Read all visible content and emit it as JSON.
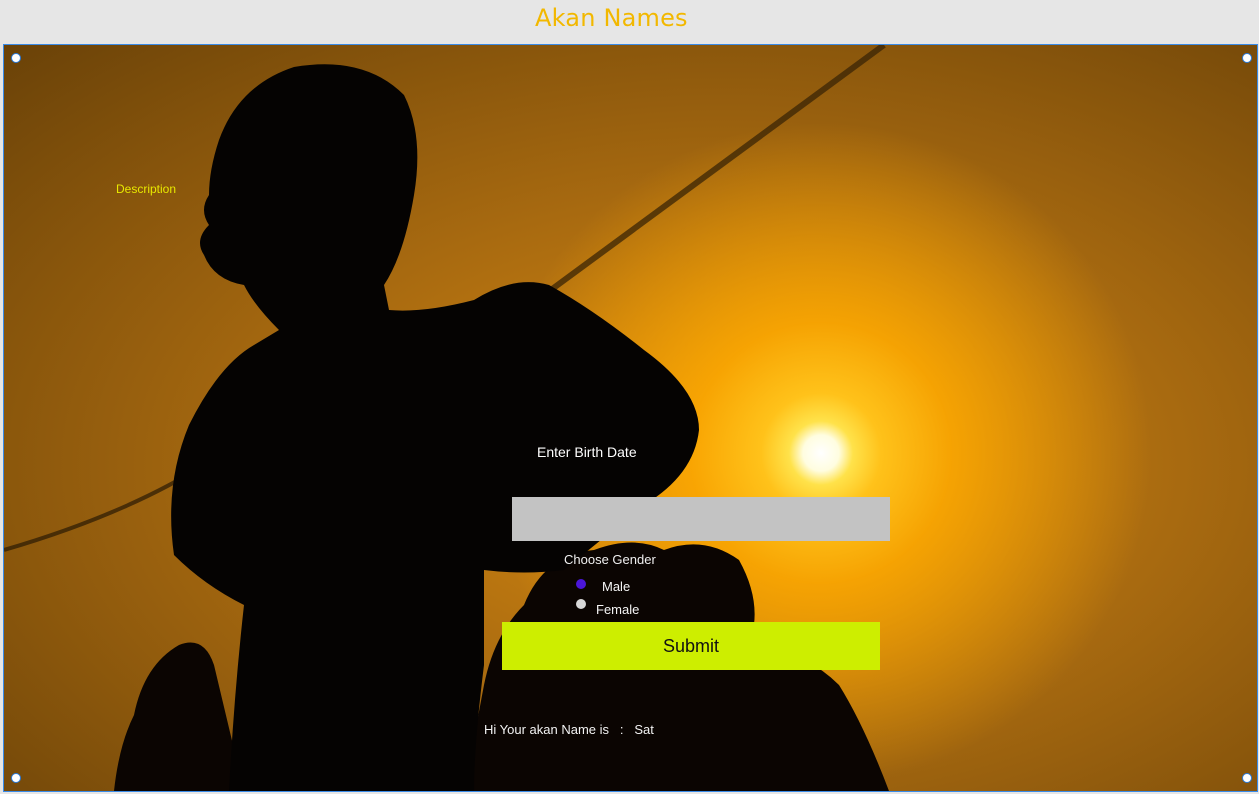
{
  "header": {
    "title": "Akan Names"
  },
  "page": {
    "description_link": "Description"
  },
  "form": {
    "birth_label": "Enter Birth Date",
    "birth_value": "",
    "gender_label": "Choose Gender",
    "gender_options": [
      {
        "label": "Male",
        "selected": true
      },
      {
        "label": "Female",
        "selected": false
      }
    ],
    "submit_label": "Submit"
  },
  "result": {
    "prefix": "Hi Your akan Name is",
    "separator": ":",
    "value": "Sat"
  },
  "colors": {
    "title": "#f2b800",
    "accent_button": "#cdee00",
    "description_text": "#e8e800",
    "input_bg": "#c3c3c3",
    "radio_selected": "#4a16d9",
    "radio_unselected": "#d8d8d8"
  },
  "background": {
    "image": "silhouette-at-sunset-photo"
  }
}
